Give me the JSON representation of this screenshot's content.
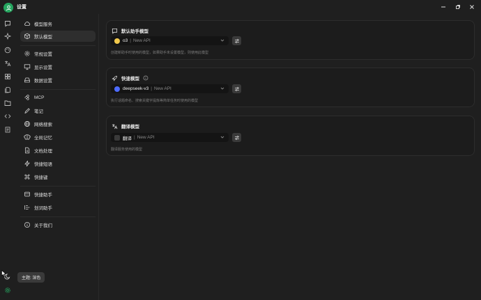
{
  "window": {
    "title": "设置"
  },
  "sidebar": {
    "items": [
      {
        "label": "模型服务",
        "icon": "cloud-icon"
      },
      {
        "label": "默认模型",
        "icon": "cube-icon",
        "active": true
      },
      {
        "label": "常规设置",
        "icon": "settings-icon"
      },
      {
        "label": "显示设置",
        "icon": "monitor-icon"
      },
      {
        "label": "数据设置",
        "icon": "hard-drive-icon"
      },
      {
        "label": "MCP",
        "icon": "mcp-icon"
      },
      {
        "label": "笔记",
        "icon": "note-icon"
      },
      {
        "label": "网络搜索",
        "icon": "globe-icon"
      },
      {
        "label": "全局记忆",
        "icon": "brain-icon"
      },
      {
        "label": "文档处理",
        "icon": "file-text-icon"
      },
      {
        "label": "快捷短语",
        "icon": "zap-icon"
      },
      {
        "label": "快捷键",
        "icon": "command-icon"
      },
      {
        "label": "快捷助手",
        "icon": "package-icon"
      },
      {
        "label": "划词助手",
        "icon": "text-select-icon"
      },
      {
        "label": "关于我们",
        "icon": "info-icon"
      }
    ]
  },
  "cards": [
    {
      "title": "默认助手模型",
      "model": "o3",
      "provider": "New API",
      "description": "创建新助手时使用的模型，如果助手未设置模型，则使用此模型",
      "logo_color": "#f2c94c"
    },
    {
      "title": "快速模型",
      "model": "deepseek-v3",
      "provider": "New API",
      "description": "执行话题命名、搜索关键字提炼等简单任务时使用的模型",
      "logo_color": "#4d6bfe"
    },
    {
      "title": "翻译模型",
      "model": "翻译",
      "provider": "New API",
      "description": "翻译服务使用的模型",
      "logo_color": "#3a3a3a"
    }
  ],
  "tooltip": {
    "text": "主题: 深色"
  },
  "colors": {
    "accent": "#25a55f",
    "background": "#1f1f1f"
  }
}
